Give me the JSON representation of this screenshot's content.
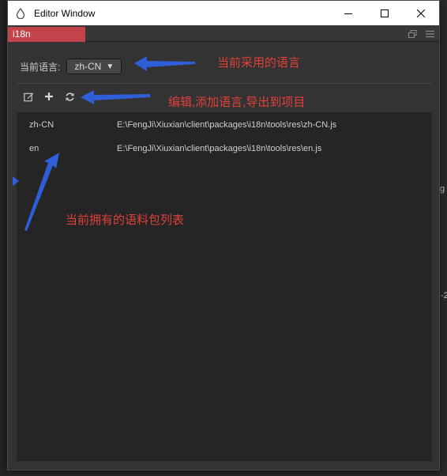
{
  "window": {
    "title": "Editor Window"
  },
  "tab": {
    "label": "i18n"
  },
  "language_selector": {
    "label": "当前语言:",
    "value": "zh-CN",
    "arrow": "▼"
  },
  "toolbar": {
    "edit_icon": "edit-icon",
    "add_icon": "plus-icon",
    "refresh_icon": "refresh-icon"
  },
  "language_list": [
    {
      "code": "zh-CN",
      "path": "E:\\FengJi\\Xiuxian\\client\\packages\\i18n\\tools\\res\\zh-CN.js"
    },
    {
      "code": "en",
      "path": "E:\\FengJi\\Xiuxian\\client\\packages\\i18n\\tools\\res\\en.js"
    }
  ],
  "annotations": {
    "current_language": "当前采用的语言",
    "toolbar_actions": "编辑,添加语言,导出到项目",
    "language_list": "当前拥有的语料包列表"
  },
  "background": {
    "fragment_g": "g",
    "fragment_num": "-2"
  },
  "colors": {
    "tab_active": "#c0444a",
    "annotation_text": "#e0403a",
    "annotation_arrow": "#2f5fd8",
    "panel_bg": "#333333",
    "list_bg": "#252525"
  }
}
